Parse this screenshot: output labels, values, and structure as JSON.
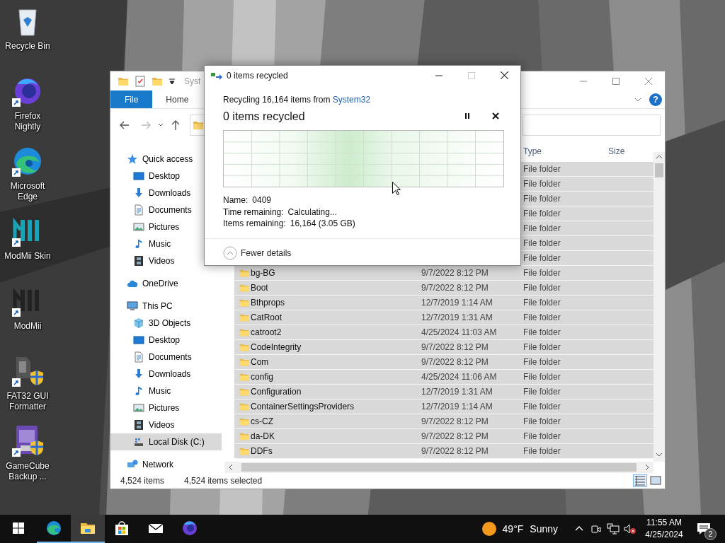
{
  "desktop_icons": [
    {
      "kind": "recycle",
      "label": "Recycle Bin"
    },
    {
      "kind": "firefox",
      "label": "Firefox Nightly"
    },
    {
      "kind": "edge",
      "label": "Microsoft Edge"
    },
    {
      "kind": "modmii_skin",
      "label": "ModMii Skin"
    },
    {
      "kind": "modmii",
      "label": "ModMii"
    },
    {
      "kind": "fat32",
      "label": "FAT32 GUI Formatter"
    },
    {
      "kind": "gamecube",
      "label": "GameCube Backup ..."
    }
  ],
  "explorer": {
    "title": "Syst",
    "ribbon_tabs": [
      {
        "label": "File",
        "selected": true
      },
      {
        "label": "Home",
        "selected": false
      }
    ],
    "help": "?",
    "nav": [
      {
        "kind": "star",
        "label": "Quick access",
        "selected": false,
        "children": [
          {
            "kind": "desktop",
            "label": "Desktop",
            "selected": false
          },
          {
            "kind": "download",
            "label": "Downloads",
            "selected": false
          },
          {
            "kind": "documents",
            "label": "Documents",
            "selected": false
          },
          {
            "kind": "pictures",
            "label": "Pictures",
            "selected": false
          },
          {
            "kind": "music",
            "label": "Music",
            "selected": false
          },
          {
            "kind": "videos",
            "label": "Videos",
            "selected": false
          }
        ]
      },
      {
        "kind": "cloud",
        "label": "OneDrive",
        "selected": false
      },
      {
        "kind": "pc",
        "label": "This PC",
        "selected": false,
        "children": [
          {
            "kind": "cube",
            "label": "3D Objects",
            "selected": false
          },
          {
            "kind": "desktop",
            "label": "Desktop",
            "selected": false
          },
          {
            "kind": "documents",
            "label": "Documents",
            "selected": false
          },
          {
            "kind": "download",
            "label": "Downloads",
            "selected": false
          },
          {
            "kind": "music",
            "label": "Music",
            "selected": false
          },
          {
            "kind": "pictures",
            "label": "Pictures",
            "selected": false
          },
          {
            "kind": "videos",
            "label": "Videos",
            "selected": false
          },
          {
            "kind": "disk",
            "label": "Local Disk (C:)",
            "selected": true
          }
        ]
      },
      {
        "kind": "network",
        "label": "Network",
        "selected": false
      }
    ],
    "columns": [
      {
        "label": "Type"
      },
      {
        "label": "Size"
      }
    ],
    "rows": [
      {
        "type": "File folder",
        "selected": true
      },
      {
        "type": "File folder",
        "selected": true
      },
      {
        "type": "File folder",
        "selected": true
      },
      {
        "type": "File folder",
        "selected": true
      },
      {
        "type": "File folder",
        "selected": true
      },
      {
        "type": "File folder",
        "selected": true
      },
      {
        "type": "File folder",
        "selected": true
      },
      {
        "name": "bg-BG",
        "date": "9/7/2022 8:12 PM",
        "type": "File folder",
        "selected": true
      },
      {
        "name": "Boot",
        "date": "9/7/2022 8:12 PM",
        "type": "File folder",
        "selected": true
      },
      {
        "name": "Bthprops",
        "date": "12/7/2019 1:14 AM",
        "type": "File folder",
        "selected": true
      },
      {
        "name": "CatRoot",
        "date": "12/7/2019 1:31 AM",
        "type": "File folder",
        "selected": true
      },
      {
        "name": "catroot2",
        "date": "4/25/2024 11:03 AM",
        "type": "File folder",
        "selected": true
      },
      {
        "name": "CodeIntegrity",
        "date": "9/7/2022 8:12 PM",
        "type": "File folder",
        "selected": true
      },
      {
        "name": "Com",
        "date": "9/7/2022 8:12 PM",
        "type": "File folder",
        "selected": true
      },
      {
        "name": "config",
        "date": "4/25/2024 11:06 AM",
        "type": "File folder",
        "selected": true
      },
      {
        "name": "Configuration",
        "date": "12/7/2019 1:31 AM",
        "type": "File folder",
        "selected": true
      },
      {
        "name": "ContainerSettingsProviders",
        "date": "12/7/2019 1:14 AM",
        "type": "File folder",
        "selected": true
      },
      {
        "name": "cs-CZ",
        "date": "9/7/2022 8:12 PM",
        "type": "File folder",
        "selected": true
      },
      {
        "name": "da-DK",
        "date": "9/7/2022 8:12 PM",
        "type": "File folder",
        "selected": true
      },
      {
        "name": "DDFs",
        "date": "9/7/2022 8:12 PM",
        "type": "File folder",
        "selected": true
      }
    ],
    "status": {
      "items": "4,524 items",
      "selected": "4,524 items selected"
    },
    "views": [
      {
        "kind": "details",
        "selected": true
      },
      {
        "kind": "large",
        "selected": false
      }
    ]
  },
  "dialog": {
    "title": "0 items recycled",
    "maximize_disabled": true,
    "source_prefix": "Recycling 16,164 items from ",
    "source_link": "System32",
    "heading": "0 items recycled",
    "details": [
      {
        "label": "Name:",
        "value": "0409"
      },
      {
        "label": "Time remaining:",
        "value": "Calculating..."
      },
      {
        "label": "Items remaining:",
        "value": "16,164 (3.05 GB)"
      }
    ],
    "toggle": "Fewer details"
  },
  "taskbar": {
    "apps": [
      {
        "kind": "edge",
        "running": true,
        "focused": false
      },
      {
        "kind": "explorer",
        "running": true,
        "focused": true
      },
      {
        "kind": "store",
        "running": false,
        "focused": false
      },
      {
        "kind": "mail",
        "running": false,
        "focused": false
      },
      {
        "kind": "firefox",
        "running": false,
        "focused": false
      }
    ],
    "weather": {
      "temp": "49°F",
      "condition": "Sunny"
    },
    "volume_muted": true,
    "time": "11:55 AM",
    "date": "4/25/2024",
    "notifications": "2"
  }
}
